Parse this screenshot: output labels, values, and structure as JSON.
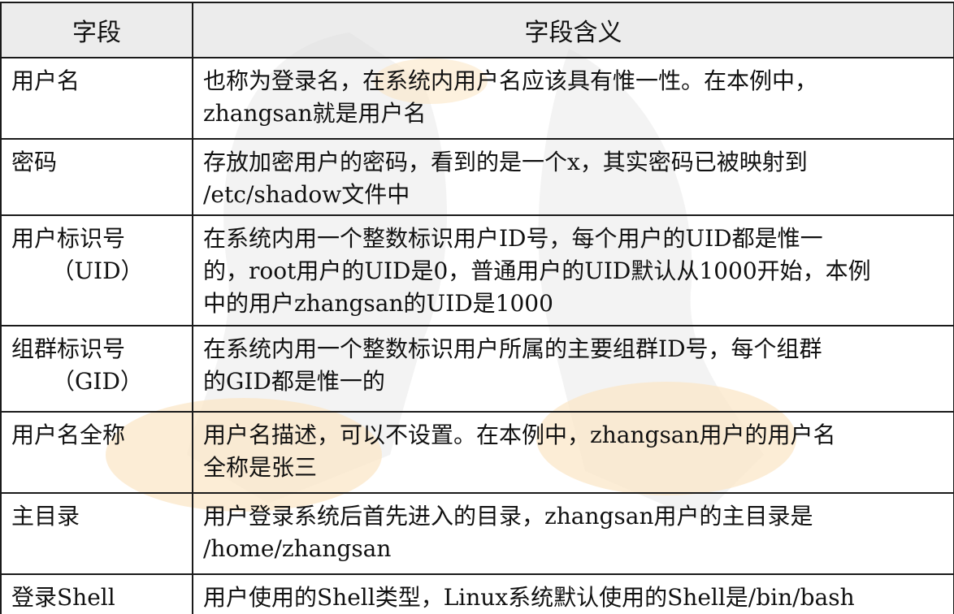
{
  "table": {
    "headers": [
      "字段",
      "字段含义"
    ],
    "rows": [
      {
        "field": "用户名",
        "field_sub": "",
        "meaning_lines": [
          "也称为登录名，在系统内用户名应该具有惟一性。在本例中，",
          "zhangsan就是用户名"
        ]
      },
      {
        "field": "密码",
        "field_sub": "",
        "meaning_lines": [
          "存放加密用户的密码，看到的是一个x，其实密码已被映射到",
          "/etc/shadow文件中"
        ]
      },
      {
        "field": "用户标识号",
        "field_sub": "（UID）",
        "meaning_lines": [
          "在系统内用一个整数标识用户ID号，每个用户的UID都是惟一",
          "的，root用户的UID是0，普通用户的UID默认从1000开始，本例",
          "中的用户zhangsan的UID是1000"
        ]
      },
      {
        "field": "组群标识号",
        "field_sub": "（GID）",
        "meaning_lines": [
          "在系统内用一个整数标识用户所属的主要组群ID号，每个组群",
          "的GID都是惟一的"
        ]
      },
      {
        "field": "用户名全称",
        "field_sub": "",
        "meaning_lines": [
          "用户名描述，可以不设置。在本例中，zhangsan用户的用户名",
          "全称是张三"
        ]
      },
      {
        "field": "主目录",
        "field_sub": "",
        "meaning_lines": [
          "用户登录系统后首先进入的目录，zhangsan用户的主目录是",
          "/home/zhangsan"
        ]
      },
      {
        "field": "登录Shell",
        "field_sub": "",
        "meaning_lines": [
          "用户使用的Shell类型，Linux系统默认使用的Shell是/bin/bash"
        ]
      }
    ]
  },
  "colors": {
    "header_bg": "#dcdcdc",
    "border": "#1a1a1a",
    "watermark_gray": "#e8e8e8",
    "watermark_orange": "#fbe7c8"
  }
}
